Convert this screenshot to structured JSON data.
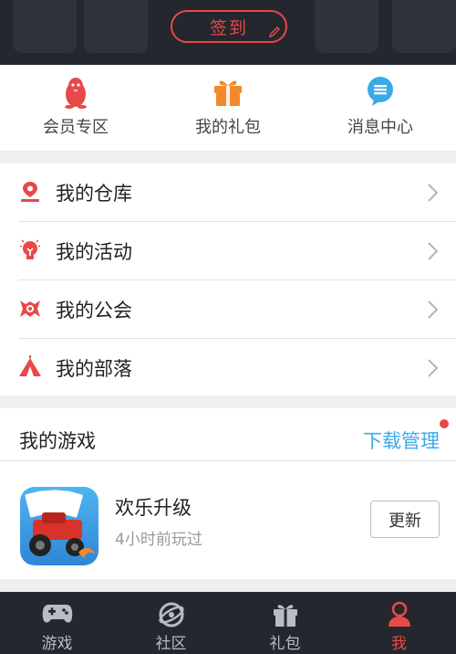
{
  "header": {
    "checkin_label": "签到"
  },
  "quick_entries": [
    {
      "label": "会员专区",
      "icon": "penguin-icon",
      "color": "#e94848"
    },
    {
      "label": "我的礼包",
      "icon": "gift-icon",
      "color": "#f08a2c"
    },
    {
      "label": "消息中心",
      "icon": "message-icon",
      "color": "#3aa9e8"
    }
  ],
  "menu": [
    {
      "label": "我的仓库",
      "icon": "warehouse-pin-icon"
    },
    {
      "label": "我的活动",
      "icon": "bulb-icon"
    },
    {
      "label": "我的公会",
      "icon": "guild-crest-icon"
    },
    {
      "label": "我的部落",
      "icon": "tent-icon"
    }
  ],
  "games": {
    "title": "我的游戏",
    "manage_label": "下载管理",
    "items": [
      {
        "name": "欢乐升级",
        "last_played": "4小时前玩过",
        "action_label": "更新"
      }
    ]
  },
  "tabbar": {
    "active": "我",
    "tabs": [
      {
        "label": "游戏",
        "icon": "gamepad-icon"
      },
      {
        "label": "社区",
        "icon": "community-icon"
      },
      {
        "label": "礼包",
        "icon": "gift-icon"
      },
      {
        "label": "我",
        "icon": "user-icon"
      }
    ]
  },
  "colors": {
    "accent": "#e94848",
    "link": "#3aa9e8",
    "dark_bar": "#24272e"
  }
}
